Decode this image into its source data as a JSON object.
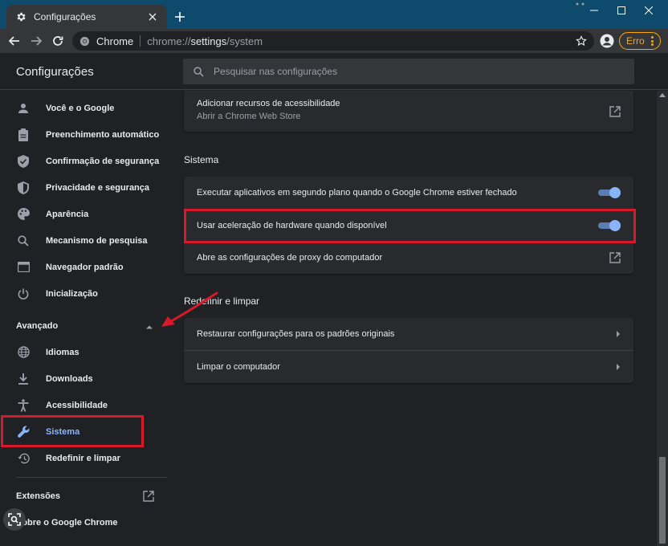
{
  "window": {
    "tab_title": "Configurações",
    "new_tab_glyph": "+",
    "controls": [
      "minimize-icon",
      "maximize-icon",
      "close-icon"
    ]
  },
  "toolbar": {
    "site_name": "Chrome",
    "url_scheme": "chrome://",
    "url_host": "settings",
    "url_path": "/system",
    "profile_error_label": "Erro"
  },
  "header": {
    "title": "Configurações",
    "search_placeholder": "Pesquisar nas configurações"
  },
  "sidebar": {
    "items": [
      {
        "label": "Você e o Google",
        "icon": "person-icon"
      },
      {
        "label": "Preenchimento automático",
        "icon": "clipboard-icon"
      },
      {
        "label": "Confirmação de segurança",
        "icon": "shield-check-icon"
      },
      {
        "label": "Privacidade e segurança",
        "icon": "shield-icon"
      },
      {
        "label": "Aparência",
        "icon": "palette-icon"
      },
      {
        "label": "Mecanismo de pesquisa",
        "icon": "search-icon"
      },
      {
        "label": "Navegador padrão",
        "icon": "browser-icon"
      },
      {
        "label": "Inicialização",
        "icon": "power-icon"
      }
    ],
    "advanced_label": "Avançado",
    "advanced_items": [
      {
        "label": "Idiomas",
        "icon": "globe-icon"
      },
      {
        "label": "Downloads",
        "icon": "download-icon"
      },
      {
        "label": "Acessibilidade",
        "icon": "accessibility-icon"
      },
      {
        "label": "Sistema",
        "icon": "wrench-icon",
        "active": true
      },
      {
        "label": "Redefinir e limpar",
        "icon": "restore-icon"
      }
    ],
    "extensions_label": "Extensões",
    "about_label": "Sobre o Google Chrome"
  },
  "main": {
    "accessibility_row": {
      "title": "Adicionar recursos de acessibilidade",
      "subtitle": "Abrir a Chrome Web Store"
    },
    "system_section": {
      "title": "Sistema",
      "rows": [
        {
          "label": "Executar aplicativos em segundo plano quando o Google Chrome estiver fechado",
          "control": "toggle",
          "on": true
        },
        {
          "label": "Usar aceleração de hardware quando disponível",
          "control": "toggle",
          "on": true
        },
        {
          "label": "Abre as configurações de proxy do computador",
          "control": "external-link-icon"
        }
      ]
    },
    "reset_section": {
      "title": "Redefinir e limpar",
      "rows": [
        {
          "label": "Restaurar configurações para os padrões originais",
          "control": "chevron-right-icon"
        },
        {
          "label": "Limpar o computador",
          "control": "chevron-right-icon"
        }
      ]
    }
  },
  "colors": {
    "title_bar": "#0e4a6b",
    "accent": "#8ab4f8",
    "annotation_red": "#d7192a",
    "error_amber": "#f9ab00"
  }
}
